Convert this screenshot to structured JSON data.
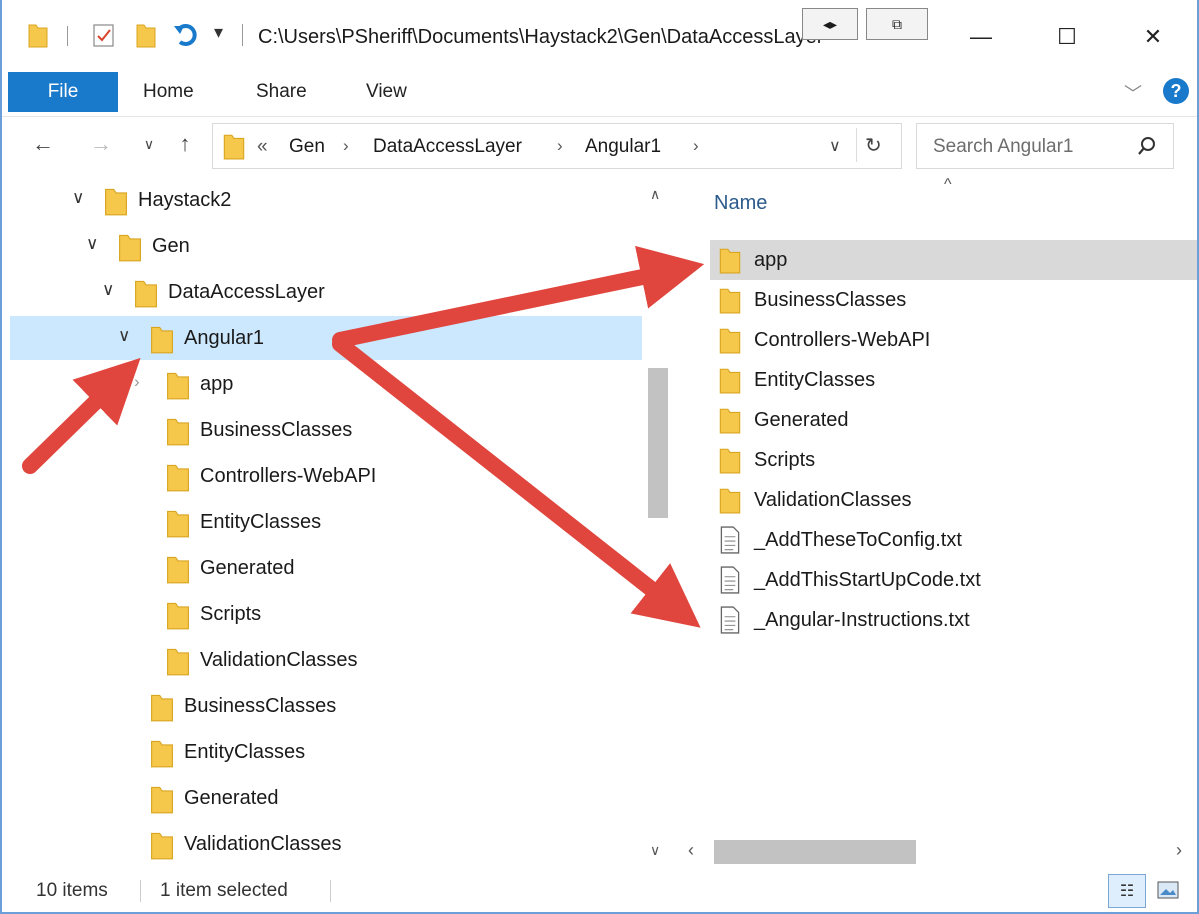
{
  "titlebar": {
    "path": "C:\\Users\\PSheriff\\Documents\\Haystack2\\Gen\\DataAccessLayer",
    "minimize": "—",
    "maximize": "☐",
    "close": "✕"
  },
  "ribbon": {
    "tabs": [
      "File",
      "Home",
      "Share",
      "View"
    ],
    "help": "?"
  },
  "address": {
    "overflow": "«",
    "crumbs": [
      "Gen",
      "DataAccessLayer",
      "Angular1"
    ],
    "search_placeholder": "Search Angular1"
  },
  "nav_tree": [
    {
      "label": "Haystack2",
      "indent": 0,
      "expanded": true,
      "selected": false
    },
    {
      "label": "Gen",
      "indent": 1,
      "expanded": true,
      "selected": false
    },
    {
      "label": "DataAccessLayer",
      "indent": 2,
      "expanded": true,
      "selected": false
    },
    {
      "label": "Angular1",
      "indent": 3,
      "expanded": true,
      "selected": true
    },
    {
      "label": "app",
      "indent": 4,
      "expanded": false,
      "selected": false,
      "has_children": true
    },
    {
      "label": "BusinessClasses",
      "indent": 4,
      "expanded": false,
      "selected": false
    },
    {
      "label": "Controllers-WebAPI",
      "indent": 4,
      "expanded": false,
      "selected": false
    },
    {
      "label": "EntityClasses",
      "indent": 4,
      "expanded": false,
      "selected": false
    },
    {
      "label": "Generated",
      "indent": 4,
      "expanded": false,
      "selected": false
    },
    {
      "label": "Scripts",
      "indent": 4,
      "expanded": false,
      "selected": false
    },
    {
      "label": "ValidationClasses",
      "indent": 4,
      "expanded": false,
      "selected": false
    },
    {
      "label": "BusinessClasses",
      "indent": 3,
      "expanded": false,
      "selected": false
    },
    {
      "label": "EntityClasses",
      "indent": 3,
      "expanded": false,
      "selected": false
    },
    {
      "label": "Generated",
      "indent": 3,
      "expanded": false,
      "selected": false
    },
    {
      "label": "ValidationClasses",
      "indent": 3,
      "expanded": false,
      "selected": false
    }
  ],
  "content": {
    "column_header": "Name",
    "items": [
      {
        "label": "app",
        "type": "folder",
        "selected": true
      },
      {
        "label": "BusinessClasses",
        "type": "folder",
        "selected": false
      },
      {
        "label": "Controllers-WebAPI",
        "type": "folder",
        "selected": false
      },
      {
        "label": "EntityClasses",
        "type": "folder",
        "selected": false
      },
      {
        "label": "Generated",
        "type": "folder",
        "selected": false
      },
      {
        "label": "Scripts",
        "type": "folder",
        "selected": false
      },
      {
        "label": "ValidationClasses",
        "type": "folder",
        "selected": false
      },
      {
        "label": "_AddTheseToConfig.txt",
        "type": "file",
        "selected": false
      },
      {
        "label": "_AddThisStartUpCode.txt",
        "type": "file",
        "selected": false
      },
      {
        "label": "_Angular-Instructions.txt",
        "type": "file",
        "selected": false
      }
    ]
  },
  "status": {
    "items_count": "10 items",
    "selection": "1 item selected"
  },
  "colors": {
    "accent": "#1979ca",
    "selected_row": "#cce8ff",
    "folder": "#f5c84c",
    "arrow": "#e0463e"
  }
}
